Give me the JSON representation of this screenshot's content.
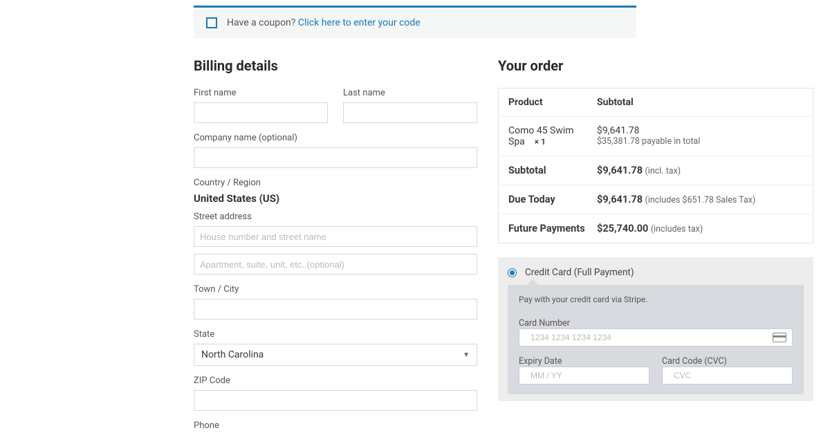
{
  "coupon": {
    "prompt": "Have a coupon?",
    "link": "Click here to enter your code"
  },
  "billing": {
    "heading": "Billing details",
    "first_name_label": "First name",
    "last_name_label": "Last name",
    "company_label": "Company name (optional)",
    "country_label": "Country / Region",
    "country_value": "United States (US)",
    "street_label": "Street address",
    "street_placeholder": "House number and street name",
    "street2_placeholder": "Apartment, suite, unit, etc. (optional)",
    "city_label": "Town / City",
    "state_label": "State",
    "state_value": "North Carolina",
    "zip_label": "ZIP Code",
    "phone_label": "Phone"
  },
  "order": {
    "heading": "Your order",
    "header_product": "Product",
    "header_subtotal": "Subtotal",
    "item_name": "Como 45 Swim Spa",
    "item_qty": "× 1",
    "item_price": "$9,641.78",
    "item_total_note": "$35,381.78 payable in total",
    "subtotal_label": "Subtotal",
    "subtotal_value": "$9,641.78",
    "subtotal_note": "(incl. tax)",
    "due_label": "Due Today",
    "due_value": "$9,641.78",
    "due_note": "(includes $651.78 Sales Tax)",
    "future_label": "Future Payments",
    "future_value": "$25,740.00",
    "future_note": "(includes tax)"
  },
  "payment": {
    "method_label": "Credit Card (Full Payment)",
    "note": "Pay with your credit card via Stripe.",
    "card_number_label": "Card Number",
    "card_number_placeholder": "1234 1234 1234 1234",
    "expiry_label": "Expiry Date",
    "expiry_placeholder": "MM / YY",
    "cvc_label": "Card Code (CVC)",
    "cvc_placeholder": "CVC"
  }
}
